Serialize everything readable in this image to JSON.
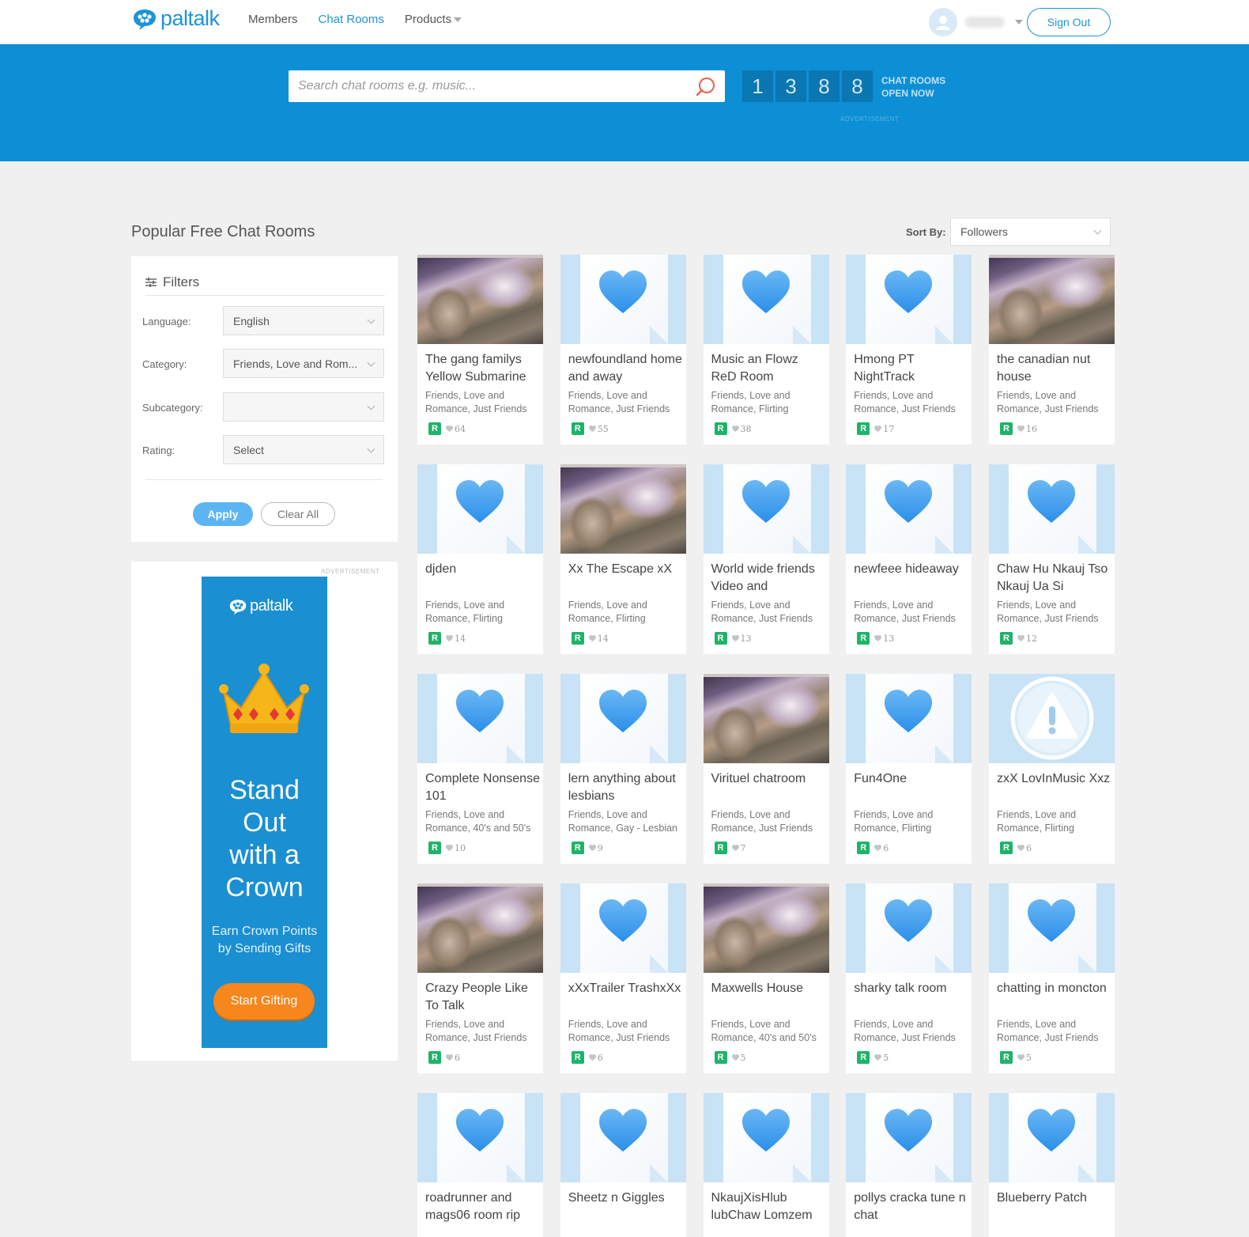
{
  "header": {
    "logo_text": "paltalk",
    "nav": [
      {
        "label": "Members",
        "active": false
      },
      {
        "label": "Chat Rooms",
        "active": true
      },
      {
        "label": "Products",
        "active": false
      }
    ],
    "sign_out_label": "Sign Out",
    "accent_color": "#1e93d6"
  },
  "banner": {
    "search_placeholder": "Search chat rooms e.g. music...",
    "counter_digits": [
      "1",
      "3",
      "8",
      "8"
    ],
    "counter_label_line1": "CHAT ROOMS",
    "counter_label_line2": "OPEN NOW",
    "ad_label": "ADVERTISEMENT",
    "background_color": "#0d8fd6"
  },
  "main": {
    "title": "Popular Free Chat Rooms",
    "sort_label": "Sort By:",
    "sort_value": "Followers"
  },
  "filters": {
    "title": "Filters",
    "language_label": "Language:",
    "language_value": "English",
    "category_label": "Category:",
    "category_value": "Friends, Love and Rom...",
    "subcategory_label": "Subcategory:",
    "subcategory_value": "",
    "rating_label": "Rating:",
    "rating_value": "Select",
    "apply_label": "Apply",
    "clear_label": "Clear All"
  },
  "ad": {
    "label": "ADVERTISEMENT",
    "logo_text": "paltalk",
    "headline_lines": [
      "Stand",
      "Out",
      "with a",
      "Crown"
    ],
    "sub_lines": [
      "Earn Crown Points",
      "by Sending Gifts"
    ],
    "button_label": "Start Gifting",
    "button_color": "#f7861c"
  },
  "rooms": [
    {
      "title": "The gang familys Yellow Submarine",
      "category": "Friends, Love and Romance, Just Friends",
      "rating": "R",
      "followers": "64",
      "thumb": "photo"
    },
    {
      "title": "newfoundland home and away",
      "category": "Friends, Love and Romance, Just Friends",
      "rating": "R",
      "followers": "55",
      "thumb": "heart"
    },
    {
      "title": "Music an Flowz ReD Room",
      "category": "Friends, Love and Romance, Flirting",
      "rating": "R",
      "followers": "38",
      "thumb": "heart"
    },
    {
      "title": "Hmong PT NightTrack",
      "category": "Friends, Love and Romance, Just Friends",
      "rating": "R",
      "followers": "17",
      "thumb": "heart"
    },
    {
      "title": "the canadian nut house",
      "category": "Friends, Love and Romance, Just Friends",
      "rating": "R",
      "followers": "16",
      "thumb": "photo"
    },
    {
      "title": "djden",
      "category": "Friends, Love and Romance, Flirting",
      "rating": "R",
      "followers": "14",
      "thumb": "heart"
    },
    {
      "title": "Xx The Escape xX",
      "category": "Friends, Love and Romance, Flirting",
      "rating": "R",
      "followers": "14",
      "thumb": "photo"
    },
    {
      "title": "World wide friends Video and",
      "category": "Friends, Love and Romance, Just Friends",
      "rating": "R",
      "followers": "13",
      "thumb": "heart"
    },
    {
      "title": "newfeee hideaway",
      "category": "Friends, Love and Romance, Just Friends",
      "rating": "R",
      "followers": "13",
      "thumb": "heart"
    },
    {
      "title": "Chaw Hu Nkauj Tso Nkauj Ua Si",
      "category": "Friends, Love and Romance, Just Friends",
      "rating": "R",
      "followers": "12",
      "thumb": "heart"
    },
    {
      "title": "Complete Nonsense 101",
      "category": "Friends, Love and Romance, 40's and 50's",
      "rating": "R",
      "followers": "10",
      "thumb": "heart"
    },
    {
      "title": "lern anything about lesbians",
      "category": "Friends, Love and Romance, Gay - Lesbian",
      "rating": "R",
      "followers": "9",
      "thumb": "heart"
    },
    {
      "title": "Virituel chatroom",
      "category": "Friends, Love and Romance, Just Friends",
      "rating": "R",
      "followers": "7",
      "thumb": "photo"
    },
    {
      "title": "Fun4One",
      "category": "Friends, Love and Romance, Flirting",
      "rating": "R",
      "followers": "6",
      "thumb": "heart"
    },
    {
      "title": "zxX LovInMusic Xxz",
      "category": "Friends, Love and Romance, Flirting",
      "rating": "R",
      "followers": "6",
      "thumb": "warn"
    },
    {
      "title": "Crazy People Like To Talk",
      "category": "Friends, Love and Romance, Just Friends",
      "rating": "R",
      "followers": "6",
      "thumb": "photo"
    },
    {
      "title": "xXxTrailer TrashxXx",
      "category": "Friends, Love and Romance, Just Friends",
      "rating": "R",
      "followers": "6",
      "thumb": "heart"
    },
    {
      "title": "Maxwells House",
      "category": "Friends, Love and Romance, 40's and 50's",
      "rating": "R",
      "followers": "5",
      "thumb": "photo"
    },
    {
      "title": "sharky talk room",
      "category": "Friends, Love and Romance, Just Friends",
      "rating": "R",
      "followers": "5",
      "thumb": "heart"
    },
    {
      "title": "chatting in moncton",
      "category": "Friends, Love and Romance, Just Friends",
      "rating": "R",
      "followers": "5",
      "thumb": "heart"
    },
    {
      "title": "roadrunner and mags06 room rip",
      "category": "",
      "rating": "",
      "followers": "",
      "thumb": "heart"
    },
    {
      "title": "Sheetz n Giggles",
      "category": "",
      "rating": "",
      "followers": "",
      "thumb": "heart"
    },
    {
      "title": "NkaujXisHlub lubChaw Lomzem",
      "category": "",
      "rating": "",
      "followers": "",
      "thumb": "heart"
    },
    {
      "title": "pollys cracka tune n chat",
      "category": "",
      "rating": "",
      "followers": "",
      "thumb": "heart"
    },
    {
      "title": "Blueberry Patch",
      "category": "",
      "rating": "",
      "followers": "",
      "thumb": "heart"
    }
  ]
}
